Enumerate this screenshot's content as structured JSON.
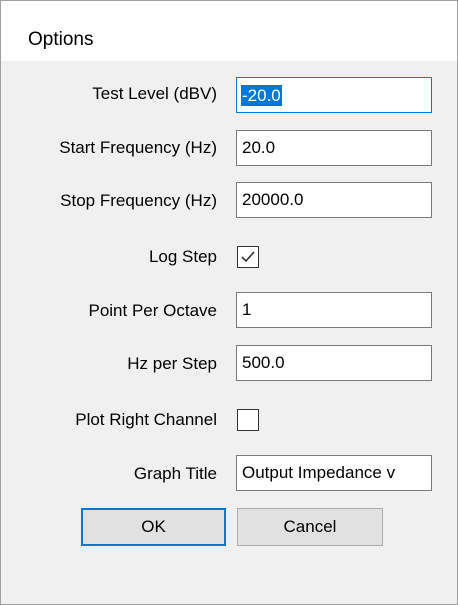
{
  "window": {
    "title": "Options"
  },
  "fields": {
    "test_level": {
      "label": "Test Level (dBV)",
      "value": "-20.0"
    },
    "start_frequency": {
      "label": "Start Frequency (Hz)",
      "value": "20.0"
    },
    "stop_frequency": {
      "label": "Stop Frequency (Hz)",
      "value": "20000.0"
    },
    "log_step": {
      "label": "Log Step",
      "checked": true
    },
    "points_per_octave": {
      "label": "Point Per Octave",
      "value": "1"
    },
    "hz_per_step": {
      "label": "Hz per Step",
      "value": "500.0"
    },
    "plot_right_channel": {
      "label": "Plot Right Channel",
      "checked": false
    },
    "graph_title": {
      "label": "Graph Title",
      "value": "Output Impedance v"
    }
  },
  "buttons": {
    "ok": "OK",
    "cancel": "Cancel"
  },
  "colors": {
    "accent": "#0078d7",
    "dialog_background": "#f0f0f0",
    "button_face": "#e1e1e1"
  }
}
